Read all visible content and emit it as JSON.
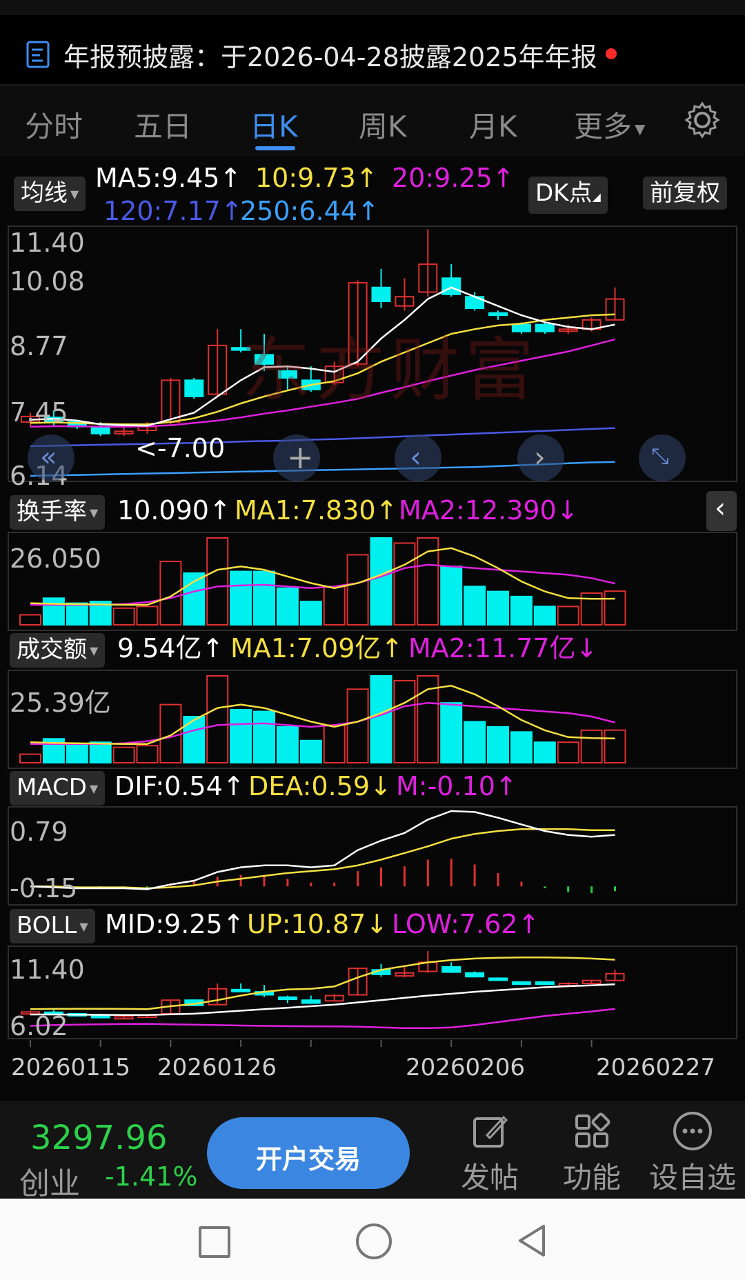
{
  "announcement": {
    "text": "年报预披露：于2026-04-28披露2025年年报"
  },
  "tabs": [
    "分时",
    "五日",
    "日K",
    "周K",
    "月K",
    "更多"
  ],
  "active_tab": 2,
  "ma_header": {
    "chip": "均线",
    "ma5": "MA5:9.45↑",
    "ma10": "10:9.73↑",
    "ma20": "20:9.25↑",
    "ma120": "120:7.17↑",
    "ma250": "250:6.44↑",
    "dk_button": "DK点",
    "adjust_button": "前复权"
  },
  "price_axis": [
    "11.40",
    "10.08",
    "8.77",
    "7.45",
    "6.14"
  ],
  "price_marker": "<-7.00",
  "turnover": {
    "chip": "换手率",
    "value": "10.090↑",
    "ma1": "MA1:7.830↑",
    "ma2": "MA2:12.390↓",
    "axis_max": "26.050"
  },
  "amount": {
    "chip": "成交额",
    "value": "9.54亿↑",
    "ma1": "MA1:7.09亿↑",
    "ma2": "MA2:11.77亿↓",
    "axis_max": "25.39亿"
  },
  "macd": {
    "chip": "MACD",
    "dif": "DIF:0.54↑",
    "dea": "DEA:0.59↓",
    "m": "M:-0.10↑",
    "axis_max": "0.79",
    "axis_min": "-0.15"
  },
  "boll": {
    "chip": "BOLL",
    "mid": "MID:9.25↑",
    "up": "UP:10.87↓",
    "low": "LOW:7.62↑",
    "axis_max": "11.40",
    "axis_min": "6.02"
  },
  "dates": [
    "20260115",
    "20260126",
    "20260206",
    "20260227"
  ],
  "bottom": {
    "index_value": "3297.96",
    "index_name": "创业",
    "index_change": "-1.41%",
    "trade_button": "开户交易",
    "post": "发帖",
    "function": "功能",
    "watchlist": "设自选"
  },
  "watermark": "东方财富",
  "colors": {
    "up": "#e03030",
    "down": "#00f0f0",
    "ma5": "#ffffff",
    "ma10": "#f5e040",
    "ma20": "#e020e0",
    "ma120": "#4a5ae8",
    "ma250": "#3aa0ff",
    "accent": "#3d8ef0"
  },
  "chart_data": {
    "type": "candlestick",
    "count": 26,
    "ylim": [
      6.14,
      11.4
    ],
    "candles": [
      {
        "o": 7.3,
        "c": 7.42,
        "h": 7.5,
        "l": 7.2
      },
      {
        "o": 7.4,
        "c": 7.3,
        "h": 7.55,
        "l": 7.2
      },
      {
        "o": 7.3,
        "c": 7.2,
        "h": 7.35,
        "l": 7.15
      },
      {
        "o": 7.18,
        "c": 7.05,
        "h": 7.3,
        "l": 7.0
      },
      {
        "o": 7.05,
        "c": 7.1,
        "h": 7.2,
        "l": 7.0
      },
      {
        "o": 7.12,
        "c": 7.2,
        "h": 7.3,
        "l": 7.05
      },
      {
        "o": 7.3,
        "c": 8.2,
        "h": 8.25,
        "l": 7.25
      },
      {
        "o": 8.2,
        "c": 7.85,
        "h": 8.25,
        "l": 7.8
      },
      {
        "o": 7.9,
        "c": 8.95,
        "h": 9.3,
        "l": 7.85
      },
      {
        "o": 8.9,
        "c": 8.85,
        "h": 9.3,
        "l": 8.8
      },
      {
        "o": 8.75,
        "c": 8.55,
        "h": 9.2,
        "l": 8.4
      },
      {
        "o": 8.4,
        "c": 8.25,
        "h": 8.5,
        "l": 8.0
      },
      {
        "o": 8.2,
        "c": 8.0,
        "h": 8.5,
        "l": 7.95
      },
      {
        "o": 8.15,
        "c": 8.5,
        "h": 8.6,
        "l": 8.1
      },
      {
        "o": 8.55,
        "c": 10.3,
        "h": 10.35,
        "l": 8.5
      },
      {
        "o": 10.2,
        "c": 9.9,
        "h": 10.6,
        "l": 9.75
      },
      {
        "o": 9.8,
        "c": 10.0,
        "h": 10.4,
        "l": 9.7
      },
      {
        "o": 10.1,
        "c": 10.7,
        "h": 11.45,
        "l": 10.0
      },
      {
        "o": 10.4,
        "c": 10.05,
        "h": 10.7,
        "l": 10.0
      },
      {
        "o": 10.0,
        "c": 9.75,
        "h": 10.1,
        "l": 9.7
      },
      {
        "o": 9.65,
        "c": 9.6,
        "h": 9.7,
        "l": 9.5
      },
      {
        "o": 9.4,
        "c": 9.25,
        "h": 9.45,
        "l": 9.2
      },
      {
        "o": 9.4,
        "c": 9.25,
        "h": 9.45,
        "l": 9.2
      },
      {
        "o": 9.3,
        "c": 9.3,
        "h": 9.4,
        "l": 9.2
      },
      {
        "o": 9.3,
        "c": 9.5,
        "h": 9.55,
        "l": 9.25
      },
      {
        "o": 9.5,
        "c": 9.95,
        "h": 10.2,
        "l": 9.5
      }
    ],
    "ma5": [
      7.35,
      7.37,
      7.33,
      7.25,
      7.23,
      7.22,
      7.36,
      7.5,
      7.85,
      8.2,
      8.48,
      8.5,
      8.45,
      8.38,
      8.6,
      9.1,
      9.5,
      9.95,
      10.2,
      10.0,
      9.8,
      9.6,
      9.45,
      9.35,
      9.3,
      9.4
    ],
    "ma10": [
      7.28,
      7.29,
      7.28,
      7.26,
      7.25,
      7.25,
      7.3,
      7.38,
      7.52,
      7.7,
      7.85,
      7.98,
      8.1,
      8.18,
      8.35,
      8.6,
      8.8,
      9.0,
      9.2,
      9.3,
      9.38,
      9.42,
      9.5,
      9.55,
      9.6,
      9.62
    ],
    "ma20": [
      7.2,
      7.21,
      7.21,
      7.2,
      7.2,
      7.21,
      7.23,
      7.28,
      7.33,
      7.4,
      7.48,
      7.55,
      7.63,
      7.71,
      7.8,
      7.93,
      8.05,
      8.18,
      8.3,
      8.42,
      8.52,
      8.62,
      8.72,
      8.82,
      8.95,
      9.08
    ],
    "ma120": [
      6.78,
      6.79,
      6.8,
      6.81,
      6.82,
      6.83,
      6.84,
      6.85,
      6.86,
      6.88,
      6.89,
      6.9,
      6.92,
      6.93,
      6.95,
      6.97,
      6.99,
      7.01,
      7.03,
      7.05,
      7.07,
      7.09,
      7.11,
      7.13,
      7.15,
      7.17
    ],
    "ma250": [
      6.14,
      6.15,
      6.16,
      6.17,
      6.18,
      6.19,
      6.2,
      6.21,
      6.22,
      6.23,
      6.24,
      6.25,
      6.26,
      6.27,
      6.28,
      6.29,
      6.3,
      6.31,
      6.32,
      6.33,
      6.35,
      6.37,
      6.39,
      6.41,
      6.43,
      6.44
    ],
    "turnover": [
      3.0,
      8.0,
      6.5,
      7.0,
      5.0,
      5.5,
      19.0,
      15.5,
      26.05,
      16.0,
      16.0,
      11.0,
      7.0,
      11.5,
      21.0,
      26.05,
      24.5,
      26.05,
      17.5,
      11.5,
      10.0,
      8.5,
      5.5,
      5.5,
      9.5,
      10.09
    ],
    "turnover_ma1": [
      6.5,
      6.3,
      6.2,
      6.1,
      6.0,
      6.0,
      8.5,
      13.0,
      16.5,
      17.5,
      16.5,
      14.5,
      12.5,
      11.0,
      12.5,
      15.0,
      18.0,
      22.0,
      23.0,
      20.5,
      17.0,
      13.0,
      10.0,
      8.0,
      7.8,
      7.83
    ],
    "turnover_ma2": [
      6.0,
      6.0,
      6.0,
      6.0,
      6.2,
      6.8,
      8.0,
      10.0,
      11.5,
      11.8,
      12.0,
      11.5,
      11.0,
      11.5,
      12.5,
      14.5,
      17.0,
      18.0,
      17.5,
      17.0,
      16.5,
      16.0,
      15.5,
      15.0,
      14.0,
      12.39
    ],
    "amount": [
      2.5,
      7.0,
      5.5,
      6.0,
      4.5,
      5.0,
      17.0,
      13.5,
      25.39,
      15.5,
      15.0,
      10.5,
      6.5,
      11.0,
      21.5,
      25.39,
      24.0,
      25.39,
      17.5,
      12.0,
      10.5,
      9.0,
      6.0,
      6.0,
      9.5,
      9.54
    ],
    "amount_ma1": [
      6.0,
      5.8,
      5.7,
      5.6,
      5.5,
      5.5,
      8.0,
      12.5,
      16.0,
      17.0,
      16.0,
      14.0,
      12.0,
      10.5,
      12.0,
      14.5,
      17.5,
      21.5,
      22.5,
      20.0,
      16.5,
      12.5,
      9.5,
      7.5,
      7.2,
      7.09
    ],
    "amount_ma2": [
      5.5,
      5.5,
      5.5,
      5.5,
      5.7,
      6.3,
      7.5,
      9.5,
      11.0,
      11.3,
      11.5,
      11.0,
      10.5,
      11.0,
      12.0,
      14.0,
      16.5,
      17.5,
      17.0,
      16.5,
      16.0,
      15.5,
      15.0,
      14.5,
      13.5,
      11.77
    ],
    "macd_ylim": [
      -0.15,
      0.79
    ],
    "macd_dif": [
      0.0,
      -0.01,
      -0.02,
      -0.02,
      -0.02,
      -0.03,
      0.02,
      0.06,
      0.15,
      0.2,
      0.22,
      0.22,
      0.2,
      0.22,
      0.38,
      0.48,
      0.56,
      0.7,
      0.79,
      0.78,
      0.72,
      0.65,
      0.58,
      0.54,
      0.52,
      0.54
    ],
    "macd_dea": [
      0.0,
      0.0,
      -0.01,
      -0.01,
      -0.01,
      -0.02,
      -0.01,
      0.01,
      0.05,
      0.08,
      0.11,
      0.14,
      0.16,
      0.18,
      0.22,
      0.28,
      0.35,
      0.42,
      0.5,
      0.55,
      0.58,
      0.6,
      0.6,
      0.6,
      0.59,
      0.59
    ],
    "macd_m": [
      0.0,
      -0.02,
      -0.02,
      -0.02,
      -0.02,
      -0.02,
      0.06,
      0.1,
      0.2,
      0.24,
      0.22,
      0.16,
      0.08,
      0.08,
      0.32,
      0.4,
      0.42,
      0.56,
      0.58,
      0.46,
      0.28,
      0.1,
      -0.04,
      -0.12,
      -0.14,
      -0.1
    ],
    "boll_ylim": [
      6.02,
      11.4
    ],
    "boll_up": [
      7.6,
      7.62,
      7.63,
      7.63,
      7.62,
      7.6,
      7.8,
      7.95,
      8.2,
      8.5,
      8.75,
      8.9,
      8.95,
      9.1,
      9.7,
      10.2,
      10.45,
      10.7,
      10.85,
      10.95,
      11.0,
      11.02,
      11.02,
      11.0,
      10.95,
      10.87
    ],
    "boll_mid": [
      7.25,
      7.25,
      7.24,
      7.23,
      7.22,
      7.22,
      7.26,
      7.3,
      7.4,
      7.5,
      7.6,
      7.7,
      7.8,
      7.9,
      8.05,
      8.2,
      8.35,
      8.5,
      8.62,
      8.75,
      8.85,
      8.95,
      9.05,
      9.12,
      9.18,
      9.25
    ],
    "boll_low": [
      6.5,
      6.55,
      6.58,
      6.6,
      6.62,
      6.63,
      6.6,
      6.58,
      6.55,
      6.52,
      6.5,
      6.48,
      6.47,
      6.46,
      6.45,
      6.4,
      6.35,
      6.35,
      6.4,
      6.55,
      6.75,
      6.95,
      7.15,
      7.3,
      7.45,
      7.62
    ]
  }
}
